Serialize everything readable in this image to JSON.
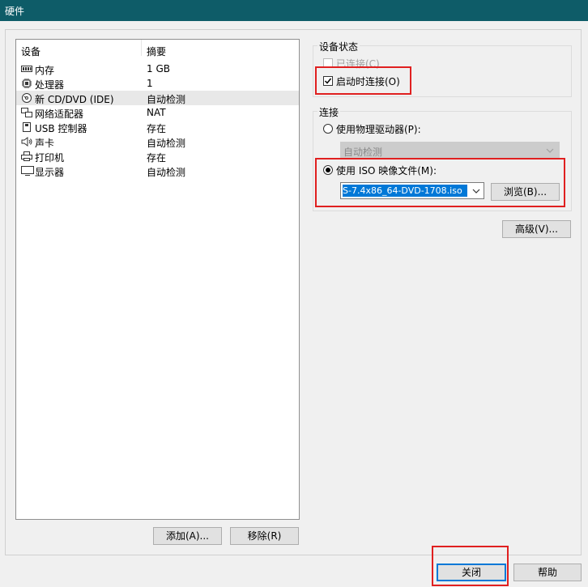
{
  "window": {
    "title": "硬件"
  },
  "device_list": {
    "headers": {
      "device": "设备",
      "summary": "摘要"
    },
    "rows": [
      {
        "icon": "memory-icon",
        "name": "内存",
        "summary": "1 GB"
      },
      {
        "icon": "processor-icon",
        "name": "处理器",
        "summary": "1"
      },
      {
        "icon": "cd-dvd-icon",
        "name": "新 CD/DVD (IDE)",
        "summary": "自动检测"
      },
      {
        "icon": "network-adapter-icon",
        "name": "网络适配器",
        "summary": "NAT"
      },
      {
        "icon": "usb-icon",
        "name": "USB 控制器",
        "summary": "存在"
      },
      {
        "icon": "speaker-icon",
        "name": "声卡",
        "summary": "自动检测"
      },
      {
        "icon": "printer-icon",
        "name": "打印机",
        "summary": "存在"
      },
      {
        "icon": "display-icon",
        "name": "显示器",
        "summary": "自动检测"
      }
    ],
    "add_label": "添加(A)...",
    "remove_label": "移除(R)"
  },
  "device_status": {
    "title": "设备状态",
    "connected_label": "已连接(C)",
    "connected_checked": false,
    "connect_at_power_on_label": "启动时连接(O)",
    "connect_at_power_on_checked": true
  },
  "connection": {
    "title": "连接",
    "physical_label": "使用物理驱动器(P):",
    "physical_value": "自动检测",
    "iso_label": "使用 ISO 映像文件(M):",
    "iso_value": "S-7.4x86_64-DVD-1708.iso",
    "browse_label": "浏览(B)..."
  },
  "advanced_label": "高级(V)...",
  "footer": {
    "close_label": "关闭",
    "help_label": "帮助"
  },
  "colors": {
    "titlebar": "#0e5c68",
    "highlight": "#e02020",
    "selection": "#0078d7"
  }
}
